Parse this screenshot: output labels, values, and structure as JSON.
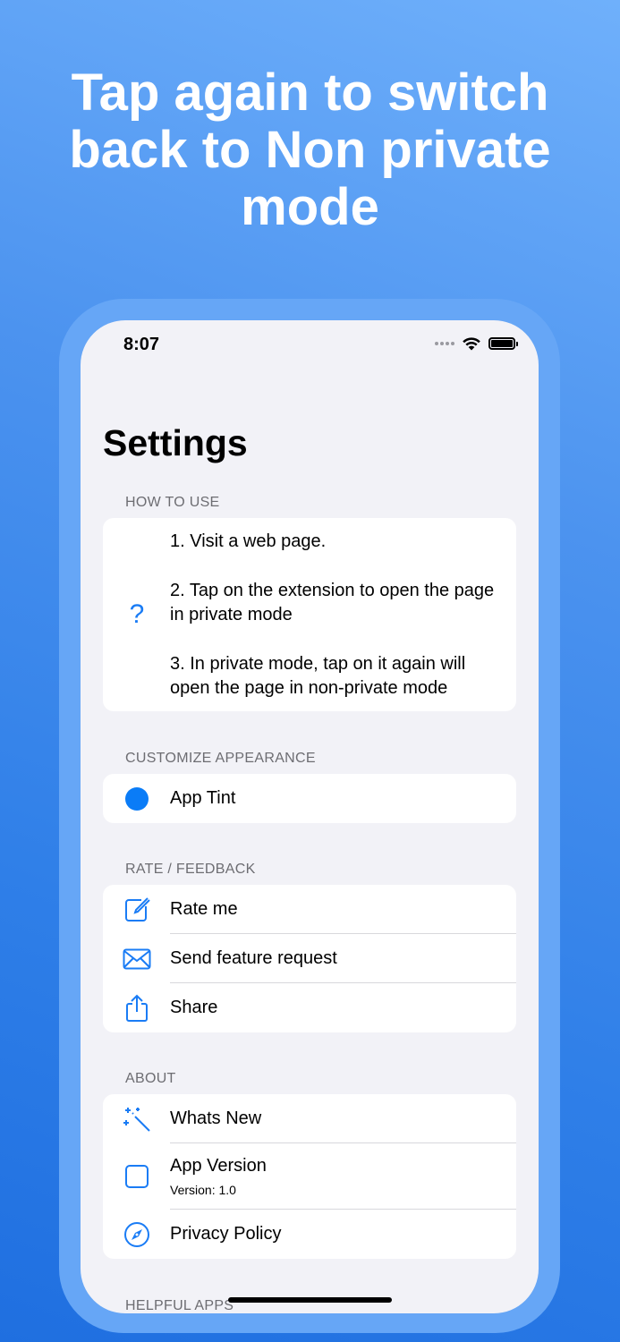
{
  "headline": "Tap again to switch\nback to Non private\nmode",
  "status_bar": {
    "time": "8:07"
  },
  "page_title": "Settings",
  "accent_color": "#1a7cf5",
  "sections": {
    "how_to_use": {
      "header": "HOW TO USE",
      "icon": "question-mark-icon",
      "steps": [
        "1. Visit a web page.",
        "2. Tap on the extension to open the page in private mode",
        "3. In private mode, tap on it again will open the page in non-private mode"
      ]
    },
    "customize": {
      "header": "CUSTOMIZE APPEARANCE",
      "app_tint_label": "App Tint",
      "tint_color": "#0a7cf7"
    },
    "rate_feedback": {
      "header": "RATE / FEEDBACK",
      "items": [
        {
          "label": "Rate me",
          "icon": "edit-icon"
        },
        {
          "label": "Send feature request",
          "icon": "envelope-icon"
        },
        {
          "label": "Share",
          "icon": "share-icon"
        }
      ]
    },
    "about": {
      "header": "ABOUT",
      "whats_new": "Whats New",
      "app_version_label": "App Version",
      "app_version_value": "Version: 1.0",
      "privacy_policy": "Privacy Policy"
    },
    "helpful_apps": {
      "header": "HELPFUL APPS"
    }
  }
}
